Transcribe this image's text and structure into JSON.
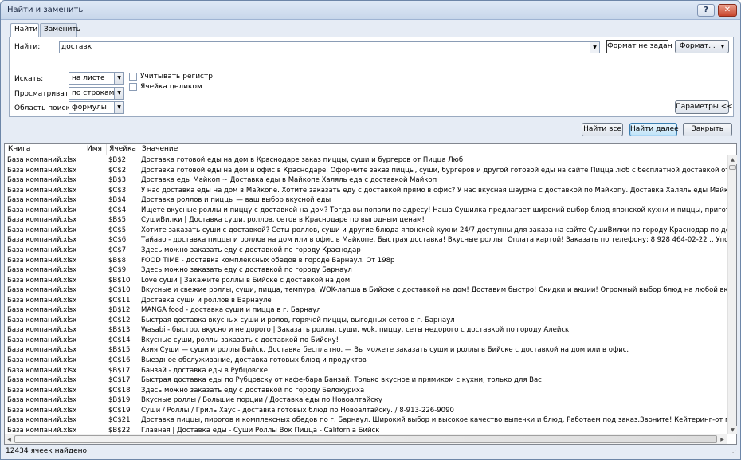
{
  "window": {
    "title": "Найти и заменить",
    "help_label": "?",
    "close_label": "✕"
  },
  "tabs": [
    {
      "label": "Найти"
    },
    {
      "label": "Заменить"
    }
  ],
  "find": {
    "label": "Найти:",
    "value": "доставк",
    "format_status": "Формат не задан",
    "format_button": "Формат..."
  },
  "options": {
    "within_label": "Искать:",
    "within_value": "на листе",
    "search_label": "Просматривать:",
    "search_value": "по строкам",
    "lookin_label": "Область поиска:",
    "lookin_value": "формулы",
    "match_case_label": "Учитывать регистр",
    "match_cell_label": "Ячейка целиком",
    "params_button": "Параметры <<"
  },
  "actions": {
    "find_all": "Найти все",
    "find_next": "Найти далее",
    "close": "Закрыть"
  },
  "results": {
    "columns": [
      "Книга",
      "Имя",
      "Ячейка",
      "Значение"
    ],
    "rows": [
      [
        "База компаний.xlsx",
        "",
        "$B$2",
        "Доставка готовой еды на дом в Краснодаре заказ пиццы, суши и бургеров от Пицца Люб"
      ],
      [
        "База компаний.xlsx",
        "",
        "$C$2",
        "Доставка готовой еды на дом и офис в Краснодаре. Оформите заказ пиццы, суши, бургеров и другой готовой еды на сайте Пицца люб с бесплатной доставкой от 500 р. рядом с домом."
      ],
      [
        "База компаний.xlsx",
        "",
        "$B$3",
        "Доставка еды Майкоп ~ Доставка еды в Майкопе Халяль еда с доставкой Майкоп"
      ],
      [
        "База компаний.xlsx",
        "",
        "$C$3",
        "У нас доставка еды на дом в Майкопе. Хотите заказать еду с доставкой прямо в офис? У нас вкусная шаурма с доставкой по Майкопу. Доставка Халяль еды Майкоп. Еда с доставкой Майкоп."
      ],
      [
        "База компаний.xlsx",
        "",
        "$B$4",
        "Доставка роллов и пиццы — ваш выбор вкусной еды"
      ],
      [
        "База компаний.xlsx",
        "",
        "$C$4",
        "Ищете вкусные роллы и пиццу с доставкой на дом? Тогда вы попали по адресу! Наша Сушилка предлагает широкий выбор блюд японской кухни и пиццы, приготовленных из свежих и качествен"
      ],
      [
        "База компаний.xlsx",
        "",
        "$B$5",
        "СушиВилки | Доставка суши, роллов, сетов в Краснодаре по выгодным ценам!"
      ],
      [
        "База компаний.xlsx",
        "",
        "$C$5",
        "Хотите заказать суши с доставкой? Сеты роллов, суши и другие блюда японской кухни 24/7 доступны для заказа на сайте СушиВилки по городу Краснодар по демократичным ценам!"
      ],
      [
        "База компаний.xlsx",
        "",
        "$C$6",
        "Тайаао - доставка пиццы и роллов на дом или в офис в Майкопе. Быстрая доставка! Вкусные роллы! Оплата картой! Заказать по телефону: 8 928 464-02-22 .. Упор на качество и сервис. Клиент"
      ],
      [
        "База компаний.xlsx",
        "",
        "$C$7",
        "Здесь можно заказать еду с доставкой по городу Краснодар"
      ],
      [
        "База компаний.xlsx",
        "",
        "$B$8",
        "FOOD TIME - доставка комплексных обедов в городе Барнаул. От 198р"
      ],
      [
        "База компаний.xlsx",
        "",
        "$C$9",
        "Здесь можно заказать еду с доставкой по городу Барнаул"
      ],
      [
        "База компаний.xlsx",
        "",
        "$B$10",
        "Love суши | Закажите роллы в Бийске с доставкой на дом"
      ],
      [
        "База компаний.xlsx",
        "",
        "$C$10",
        "Вкусные и свежие роллы, суши, пицца, темпура, WOK-лапша в Бийске с доставкой на дом! Доставим быстро! Скидки и акции! Огромный выбор блюд на любой вкус Love Суши - ресторан японско"
      ],
      [
        "База компаний.xlsx",
        "",
        "$C$11",
        "Доставка суши и роллов в Барнауле"
      ],
      [
        "База компаний.xlsx",
        "",
        "$B$12",
        "MANGA food - доставка суши и пицца в г. Барнаул"
      ],
      [
        "База компаний.xlsx",
        "",
        "$C$12",
        "Быстрая доставка вкусных суши и ролов, горячей пиццы, выгодных сетов в г. Барнаул"
      ],
      [
        "База компаний.xlsx",
        "",
        "$B$13",
        "Wasabi - быстро, вкусно и не дорого | Заказать роллы, суши, wok, пиццу, сеты недорого с доставкой по городу Алейск"
      ],
      [
        "База компаний.xlsx",
        "",
        "$C$14",
        "Вкусные суши, роллы заказать с доставкой по Бийску!"
      ],
      [
        "База компаний.xlsx",
        "",
        "$B$15",
        "Азия Суши — суши и роллы Бийск. Доставка бесплатно. — Вы можете заказать суши и роллы в Бийске с доставкой на дом или в офис."
      ],
      [
        "База компаний.xlsx",
        "",
        "$C$16",
        "Выездное обслуживание, доставка готовых блюд и продуктов"
      ],
      [
        "База компаний.xlsx",
        "",
        "$B$17",
        "Банзай - доставка еды в Рубцовске"
      ],
      [
        "База компаний.xlsx",
        "",
        "$C$17",
        "Быстрая доставка еды по Рубцовску от кафе-бара Банзай. Только вкусное и прямиком с кухни, только для Вас!"
      ],
      [
        "База компаний.xlsx",
        "",
        "$C$18",
        "Здесь можно заказать еду с доставкой по городу Белокуриха"
      ],
      [
        "База компаний.xlsx",
        "",
        "$B$19",
        "Вкусные роллы / Большие порции / Доставка еды по Новоалтайску"
      ],
      [
        "База компаний.xlsx",
        "",
        "$C$19",
        "Суши / Роллы / Гриль Хаус - доставка готовых блюд по Новоалтайску. / 8-913-226-9090"
      ],
      [
        "База компаний.xlsx",
        "",
        "$C$21",
        "Доставка пиццы, пирогов и комплексных обедов по г. Барнаул. Широкий выбор и высокое качество выпечки и блюд. Работаем под заказ.Звоните! Кейтеринг-от профессионалов. Организуем ме"
      ],
      [
        "База компаний.xlsx",
        "",
        "$B$22",
        "Главная | Доставка еды - Суши Роллы Вок Пицца - California Бийск"
      ]
    ]
  },
  "status": {
    "text": "12434 ячеек найдено"
  },
  "icons": {
    "dropdown": "chevron-down-icon",
    "scroll_up": "scroll-up-icon",
    "scroll_down": "scroll-down-icon",
    "scroll_left": "scroll-left-icon",
    "scroll_right": "scroll-right-icon"
  }
}
